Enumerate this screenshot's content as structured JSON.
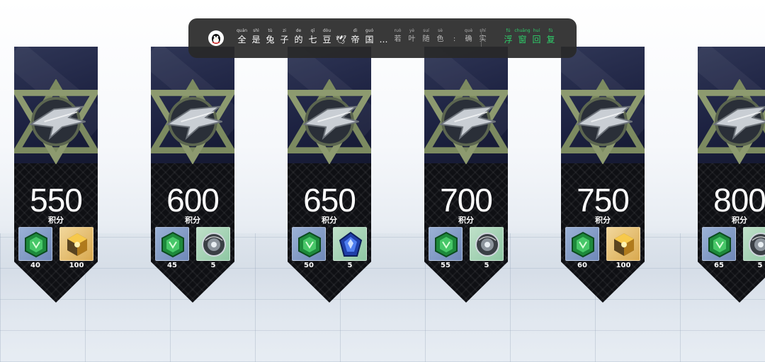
{
  "cards": [
    {
      "points": "550",
      "unit": "积分",
      "rewards": [
        {
          "icon": "green-crystal-icon",
          "frame": "blue",
          "qty": "40"
        },
        {
          "icon": "gold-cube-icon",
          "frame": "gold",
          "qty": "100"
        }
      ]
    },
    {
      "points": "600",
      "unit": "积分",
      "rewards": [
        {
          "icon": "green-crystal-icon",
          "frame": "blue",
          "qty": "45"
        },
        {
          "icon": "silver-orb-icon",
          "frame": "teal",
          "qty": "5"
        }
      ]
    },
    {
      "points": "650",
      "unit": "积分",
      "rewards": [
        {
          "icon": "green-crystal-icon",
          "frame": "blue",
          "qty": "50"
        },
        {
          "icon": "blue-gem-icon",
          "frame": "teal",
          "qty": "5"
        }
      ]
    },
    {
      "points": "700",
      "unit": "积分",
      "rewards": [
        {
          "icon": "green-crystal-icon",
          "frame": "blue",
          "qty": "55"
        },
        {
          "icon": "silver-orb-icon",
          "frame": "teal",
          "qty": "5"
        }
      ]
    },
    {
      "points": "750",
      "unit": "积分",
      "rewards": [
        {
          "icon": "green-crystal-icon",
          "frame": "blue",
          "qty": "60"
        },
        {
          "icon": "gold-cube-icon",
          "frame": "gold",
          "qty": "100"
        }
      ]
    },
    {
      "points": "800",
      "unit": "积分",
      "rewards": [
        {
          "icon": "green-crystal-icon",
          "frame": "blue",
          "qty": "65"
        },
        {
          "icon": "silver-orb-icon",
          "frame": "teal",
          "qty": "5"
        }
      ]
    }
  ],
  "lyric": {
    "line": [
      {
        "h": "全",
        "p": "quán"
      },
      {
        "h": "是",
        "p": "shì"
      },
      {
        "h": "兔",
        "p": "tù"
      },
      {
        "h": "子",
        "p": "zi"
      },
      {
        "h": "的",
        "p": "de"
      },
      {
        "h": "七",
        "p": "qī"
      },
      {
        "h": "豆",
        "p": "dòu"
      },
      {
        "h": "🕊",
        "p": ""
      },
      {
        "h": "帝",
        "p": "dì"
      },
      {
        "h": "国",
        "p": "guó"
      },
      {
        "h": "…",
        "p": ""
      }
    ],
    "meta": [
      {
        "h": "若",
        "p": "ruò"
      },
      {
        "h": "叶",
        "p": "yè"
      },
      {
        "h": "随",
        "p": "suí"
      },
      {
        "h": "色",
        "p": "sè"
      },
      {
        "h": ":",
        "p": ""
      },
      {
        "h": "确",
        "p": "què"
      },
      {
        "h": "实",
        "p": "shí"
      }
    ],
    "action": [
      {
        "h": "浮",
        "p": "fú"
      },
      {
        "h": "窗",
        "p": "chuāng"
      },
      {
        "h": "回",
        "p": "huí"
      },
      {
        "h": "复",
        "p": "fù"
      }
    ]
  }
}
